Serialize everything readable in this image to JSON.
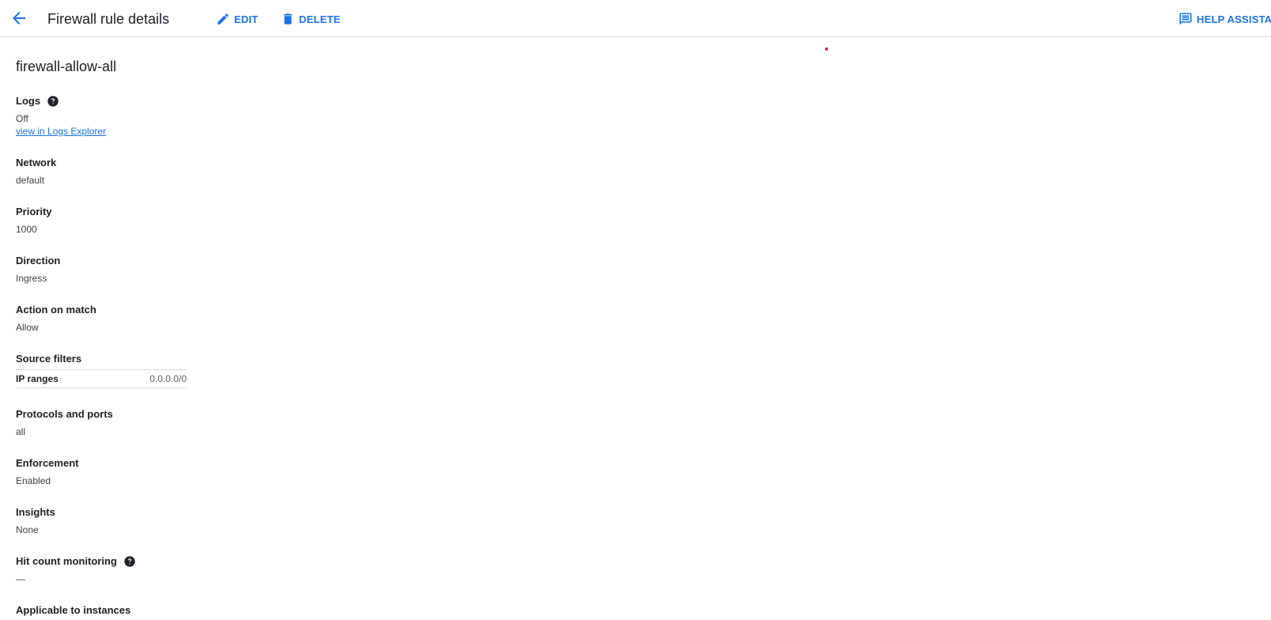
{
  "header": {
    "title": "Firewall rule details",
    "edit_label": "EDIT",
    "delete_label": "DELETE",
    "help_label": "HELP ASSISTAN"
  },
  "rule": {
    "name": "firewall-allow-all",
    "logs_label": "Logs",
    "logs_value": "Off",
    "logs_link": "view in Logs Explorer",
    "network_label": "Network",
    "network_value": "default",
    "priority_label": "Priority",
    "priority_value": "1000",
    "direction_label": "Direction",
    "direction_value": "Ingress",
    "action_label": "Action on match",
    "action_value": "Allow",
    "source_filters_label": "Source filters",
    "source_filters": [
      {
        "key": "IP ranges",
        "value": "0.0.0.0/0"
      }
    ],
    "protocols_label": "Protocols and ports",
    "protocols_value": "all",
    "enforcement_label": "Enforcement",
    "enforcement_value": "Enabled",
    "insights_label": "Insights",
    "insights_value": "None",
    "hit_count_label": "Hit count monitoring",
    "hit_count_value": "—",
    "applicable_label": "Applicable to instances"
  },
  "colors": {
    "accent": "#1a73e8",
    "text": "#202124",
    "divider": "#dadce0"
  }
}
